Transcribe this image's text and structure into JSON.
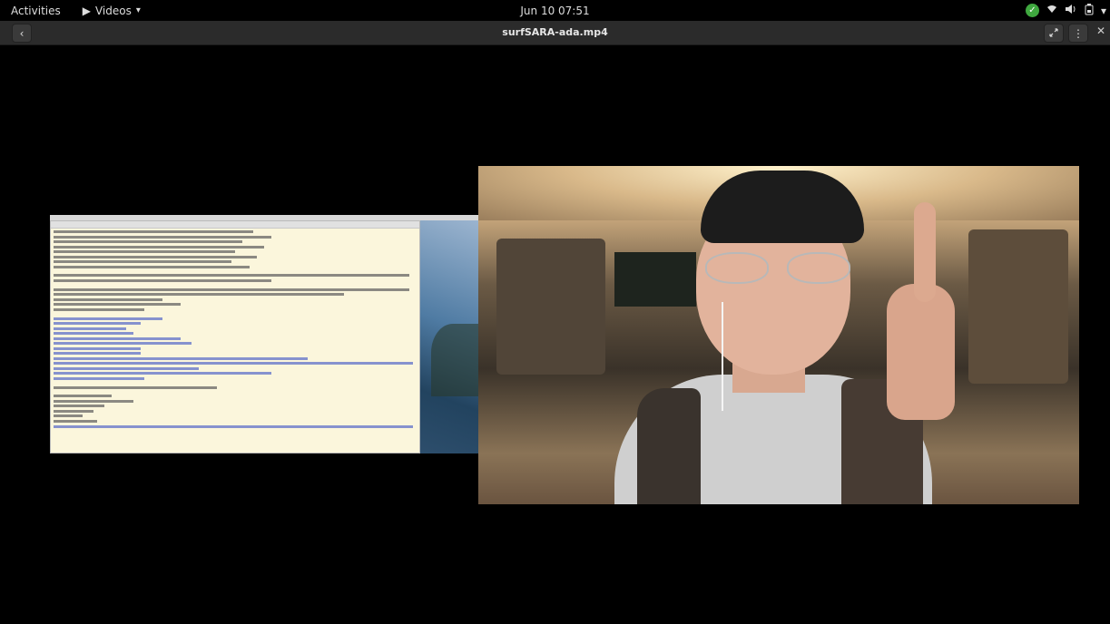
{
  "topbar": {
    "activities": "Activities",
    "app_menu": "Videos",
    "clock": "Jun 10  07:51"
  },
  "header": {
    "title": "surfSARA-ada.mp4"
  },
  "icons": {
    "back": "chevron-left-icon",
    "fullscreen": "fullscreen-icon",
    "menu": "kebab-menu-icon",
    "close": "close-icon",
    "status_ok": "check-icon",
    "wifi": "wifi-icon",
    "volume": "volume-icon",
    "battery": "battery-icon"
  },
  "colors": {
    "background": "#000000",
    "headerbar": "#2b2b2b",
    "terminal_bg": "#fbf6dc",
    "status_green": "#3fa83f"
  }
}
